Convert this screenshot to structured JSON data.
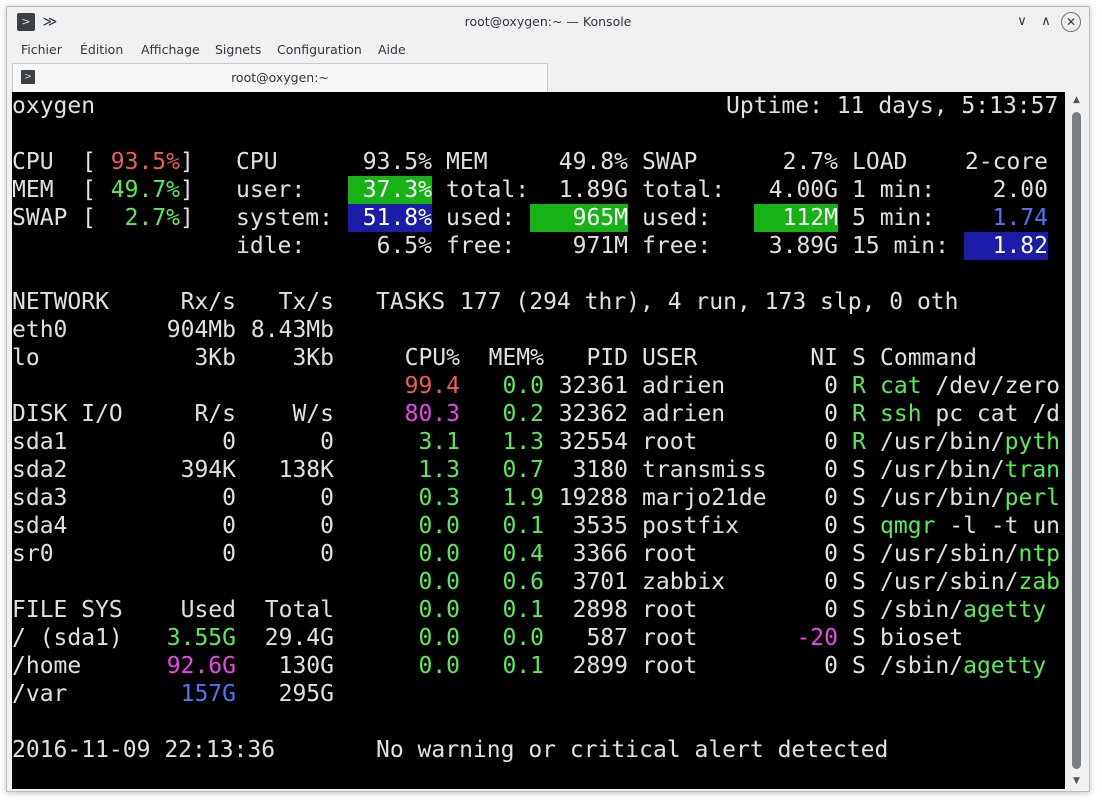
{
  "window": {
    "title": "root@oxygen:~ — Konsole",
    "app_icon": ">",
    "keep_above_icon": "≫",
    "minimize_icon": "∨",
    "maximize_icon": "∧",
    "close_icon": "✕"
  },
  "menu": [
    "Fichier",
    "Édition",
    "Affichage",
    "Signets",
    "Configuration",
    "Aide"
  ],
  "tab": {
    "label": "root@oxygen:~",
    "icon": ">"
  },
  "colors": {
    "terminal_bg": "#000000",
    "highlight_green": "#16b216",
    "highlight_blue": "#1c1ca8",
    "red": "#ef5a5a",
    "green": "#55ee55",
    "magenta": "#ee44ee",
    "blue": "#5a6cff"
  },
  "glances": {
    "hostname": "oxygen",
    "uptime": "Uptime: 11 days, 5:13:57",
    "quicklook": {
      "cpu_label": "CPU",
      "cpu_value": "93.5%",
      "mem_label": "MEM",
      "mem_value": "49.7%",
      "swap_label": "SWAP",
      "swap_value": "2.7%"
    },
    "cpu": {
      "title": "CPU",
      "total": "93.5%",
      "user_label": "user:",
      "user": "37.3%",
      "system_label": "system:",
      "system": "51.8%",
      "idle_label": "idle:",
      "idle": "6.5%"
    },
    "mem": {
      "title": "MEM",
      "percent": "49.8%",
      "total_label": "total:",
      "total": "1.89G",
      "used_label": "used:",
      "used": "965M",
      "free_label": "free:",
      "free": "971M"
    },
    "swap": {
      "title": "SWAP",
      "percent": "2.7%",
      "total_label": "total:",
      "total": "4.00G",
      "used_label": "used:",
      "used": "112M",
      "free_label": "free:",
      "free": "3.89G"
    },
    "load": {
      "title": "LOAD",
      "cores": "2-core",
      "min1_label": "1 min:",
      "min1": "2.00",
      "min5_label": "5 min:",
      "min5": "1.74",
      "min15_label": "15 min:",
      "min15": "1.82"
    },
    "network": {
      "title": "NETWORK",
      "rx_header": "Rx/s",
      "tx_header": "Tx/s",
      "rows": [
        {
          "iface": "eth0",
          "rx": "904Mb",
          "tx": "8.43Mb"
        },
        {
          "iface": "lo",
          "rx": "3Kb",
          "tx": "3Kb"
        }
      ]
    },
    "diskio": {
      "title": "DISK I/O",
      "r_header": "R/s",
      "w_header": "W/s",
      "rows": [
        {
          "disk": "sda1",
          "r": "0",
          "w": "0"
        },
        {
          "disk": "sda2",
          "r": "394K",
          "w": "138K"
        },
        {
          "disk": "sda3",
          "r": "0",
          "w": "0"
        },
        {
          "disk": "sda4",
          "r": "0",
          "w": "0"
        },
        {
          "disk": "sr0",
          "r": "0",
          "w": "0"
        }
      ]
    },
    "fs": {
      "title": "FILE SYS",
      "used_header": "Used",
      "total_header": "Total",
      "rows": [
        {
          "mount": "/ (sda1)",
          "used": "3.55G",
          "total": "29.4G",
          "color": "green"
        },
        {
          "mount": "/home",
          "used": "92.6G",
          "total": "130G",
          "color": "magenta"
        },
        {
          "mount": "/var",
          "used": "157G",
          "total": "295G",
          "color": "blue"
        }
      ]
    },
    "tasks": {
      "title": "TASKS",
      "summary": "177 (294 thr), 4 run, 173 slp, 0 oth"
    },
    "process_headers": {
      "cpu": "CPU%",
      "mem": "MEM%",
      "pid": "PID",
      "user": "USER",
      "ni": "NI",
      "s": "S",
      "command": "Command"
    },
    "processes": [
      {
        "cpu": "99.4",
        "cpu_color": "red",
        "mem": "0.0",
        "pid": "32361",
        "user": "adrien",
        "ni": "0",
        "ni_color": "white",
        "s": "R",
        "s_color": "green",
        "cmd_prefix": "",
        "cmd_name": "cat",
        "cmd_args": " /dev/zero",
        "name_color": "green"
      },
      {
        "cpu": "80.3",
        "cpu_color": "magenta",
        "mem": "0.2",
        "pid": "32362",
        "user": "adrien",
        "ni": "0",
        "ni_color": "white",
        "s": "R",
        "s_color": "green",
        "cmd_prefix": "",
        "cmd_name": "ssh",
        "cmd_args": " pc cat /d",
        "name_color": "green"
      },
      {
        "cpu": "3.1",
        "cpu_color": "green",
        "mem": "1.3",
        "pid": "32554",
        "user": "root",
        "ni": "0",
        "ni_color": "white",
        "s": "R",
        "s_color": "green",
        "cmd_prefix": "/usr/bin/",
        "cmd_name": "pyth",
        "cmd_args": "",
        "name_color": "green"
      },
      {
        "cpu": "1.3",
        "cpu_color": "green",
        "mem": "0.7",
        "pid": "3180",
        "user": "transmiss",
        "ni": "0",
        "ni_color": "white",
        "s": "S",
        "s_color": "white",
        "cmd_prefix": "/usr/bin/",
        "cmd_name": "tran",
        "cmd_args": "",
        "name_color": "green"
      },
      {
        "cpu": "0.3",
        "cpu_color": "green",
        "mem": "1.9",
        "pid": "19288",
        "user": "marjo21de",
        "ni": "0",
        "ni_color": "white",
        "s": "S",
        "s_color": "white",
        "cmd_prefix": "/usr/bin/",
        "cmd_name": "perl",
        "cmd_args": "",
        "name_color": "green"
      },
      {
        "cpu": "0.0",
        "cpu_color": "green",
        "mem": "0.1",
        "pid": "3535",
        "user": "postfix",
        "ni": "0",
        "ni_color": "white",
        "s": "S",
        "s_color": "white",
        "cmd_prefix": "",
        "cmd_name": "qmgr",
        "cmd_args": " -l -t un",
        "name_color": "green"
      },
      {
        "cpu": "0.0",
        "cpu_color": "green",
        "mem": "0.4",
        "pid": "3366",
        "user": "root",
        "ni": "0",
        "ni_color": "white",
        "s": "S",
        "s_color": "white",
        "cmd_prefix": "/usr/sbin/",
        "cmd_name": "ntp",
        "cmd_args": "",
        "name_color": "green"
      },
      {
        "cpu": "0.0",
        "cpu_color": "green",
        "mem": "0.6",
        "pid": "3701",
        "user": "zabbix",
        "ni": "0",
        "ni_color": "white",
        "s": "S",
        "s_color": "white",
        "cmd_prefix": "/usr/sbin/",
        "cmd_name": "zab",
        "cmd_args": "",
        "name_color": "green"
      },
      {
        "cpu": "0.0",
        "cpu_color": "green",
        "mem": "0.1",
        "pid": "2898",
        "user": "root",
        "ni": "0",
        "ni_color": "white",
        "s": "S",
        "s_color": "white",
        "cmd_prefix": "/sbin/",
        "cmd_name": "agetty",
        "cmd_args": "",
        "name_color": "green"
      },
      {
        "cpu": "0.0",
        "cpu_color": "green",
        "mem": "0.0",
        "pid": "587",
        "user": "root",
        "ni": "-20",
        "ni_color": "magenta",
        "s": "S",
        "s_color": "white",
        "cmd_prefix": "",
        "cmd_name": "bioset",
        "cmd_args": "",
        "name_color": "white"
      },
      {
        "cpu": "0.0",
        "cpu_color": "green",
        "mem": "0.1",
        "pid": "2899",
        "user": "root",
        "ni": "0",
        "ni_color": "white",
        "s": "S",
        "s_color": "white",
        "cmd_prefix": "/sbin/",
        "cmd_name": "agetty",
        "cmd_args": "",
        "name_color": "green"
      }
    ],
    "datetime": "2016-11-09 22:13:36",
    "alert": "No warning or critical alert detected"
  }
}
